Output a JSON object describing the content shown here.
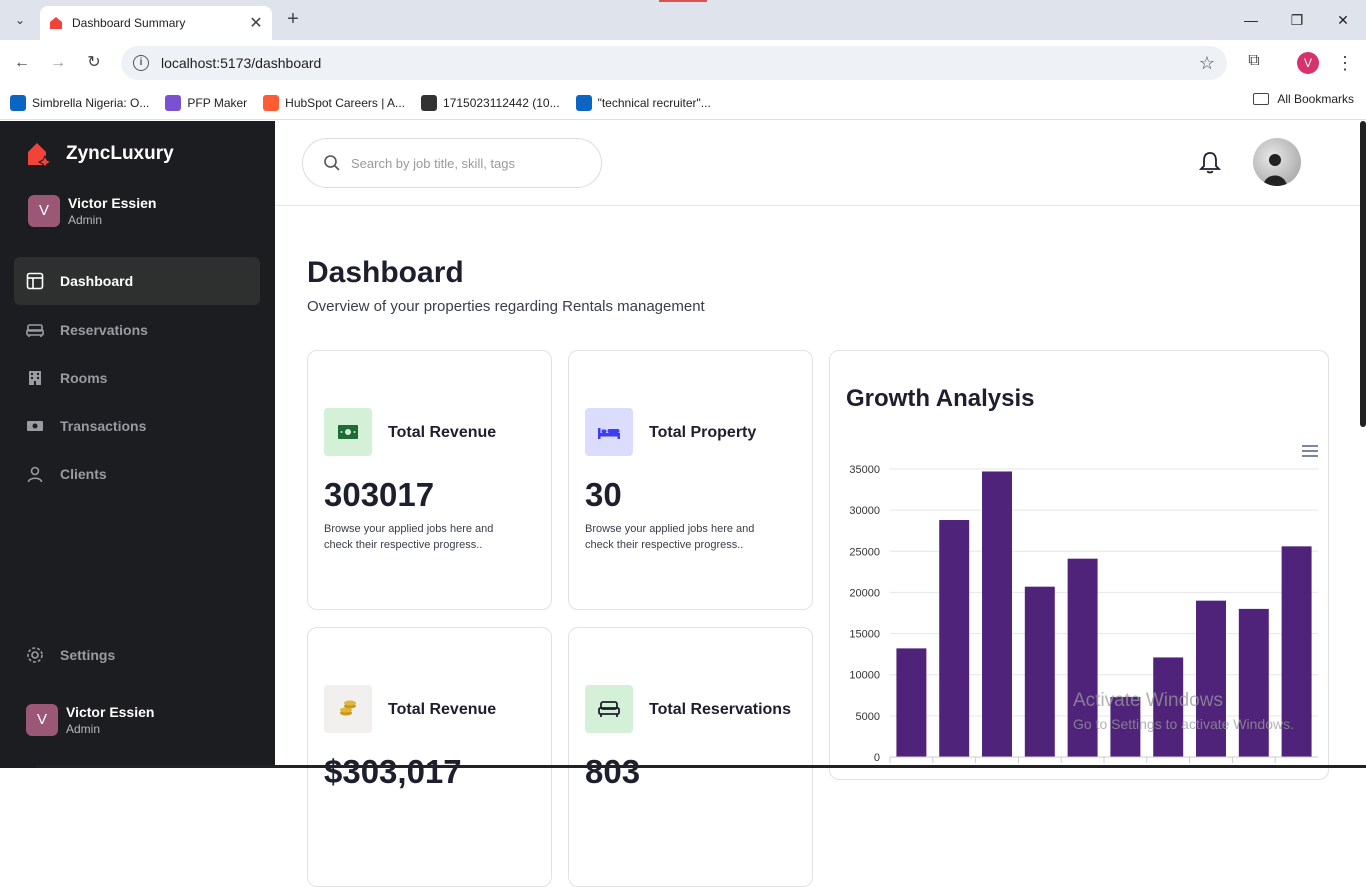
{
  "browser": {
    "tab_title": "Dashboard Summary",
    "url": "localhost:5173/dashboard",
    "profile_initial": "V",
    "bookmarks": [
      {
        "label": "Simbrella Nigeria: O...",
        "icon": "linkedin-icon",
        "color": "#0a66c2"
      },
      {
        "label": "PFP Maker",
        "icon": "pfp-maker-icon",
        "color": "#7a52d1"
      },
      {
        "label": "HubSpot Careers | A...",
        "icon": "hubspot-icon",
        "color": "#ff5c35"
      },
      {
        "label": "1715023112442 (10...",
        "icon": "globe-icon",
        "color": "#333333"
      },
      {
        "label": "\"technical recruiter\"...",
        "icon": "linkedin-icon",
        "color": "#0a66c2"
      }
    ],
    "all_bookmarks": "All Bookmarks"
  },
  "sidebar": {
    "brand": "ZyncLuxury",
    "brand_color": "#f0443a",
    "user": {
      "initial": "V",
      "name": "Victor Essien",
      "role": "Admin"
    },
    "items": [
      {
        "label": "Dashboard",
        "icon": "dashboard-icon",
        "active": true
      },
      {
        "label": "Reservations",
        "icon": "sofa-icon",
        "active": false
      },
      {
        "label": "Rooms",
        "icon": "building-icon",
        "active": false
      },
      {
        "label": "Transactions",
        "icon": "cash-icon",
        "active": false
      },
      {
        "label": "Clients",
        "icon": "user-icon",
        "active": false
      }
    ],
    "settings": "Settings",
    "footer_user": {
      "initial": "V",
      "name": "Victor Essien",
      "role": "Admin"
    }
  },
  "topbar": {
    "search_placeholder": "Search by job title, skill, tags"
  },
  "page": {
    "title": "Dashboard",
    "subtitle": "Overview of your properties regarding Rentals management"
  },
  "cards": [
    {
      "label": "Total Revenue",
      "value": "303017",
      "desc": "Browse your applied jobs here and check their respective progress..",
      "icon": "money-icon",
      "icon_bg": "#d4f0d6",
      "icon_color": "#1f6b35"
    },
    {
      "label": "Total Property",
      "value": "30",
      "desc": "Browse your applied jobs here and check their respective progress..",
      "icon": "bed-icon",
      "icon_bg": "#dcdcff",
      "icon_color": "#3d3df5"
    },
    {
      "label": "Total Revenue",
      "value": "$303,017",
      "desc": "",
      "icon": "coins-icon",
      "icon_bg": "#f1f0ee",
      "icon_color": "#c99a1a"
    },
    {
      "label": "Total Reservations",
      "value": "803",
      "desc": "",
      "icon": "sofa-icon",
      "icon_bg": "#d4f0d6",
      "icon_color": "#1d1f2e"
    }
  ],
  "chart": {
    "title": "Growth Analysis",
    "bar_color": "#4f237a"
  },
  "chart_data": {
    "type": "bar",
    "title": "Growth Analysis",
    "values": [
      13200,
      28800,
      34700,
      20700,
      24100,
      7300,
      12100,
      19000,
      18000,
      25600
    ],
    "yticks": [
      "35000",
      "30000",
      "25000",
      "20000",
      "15000",
      "10000",
      "5000",
      "0"
    ],
    "ylim": [
      0,
      35000
    ],
    "grid": true
  },
  "watermark": {
    "line1": "Activate Windows",
    "line2": "Go to Settings to activate Windows."
  }
}
